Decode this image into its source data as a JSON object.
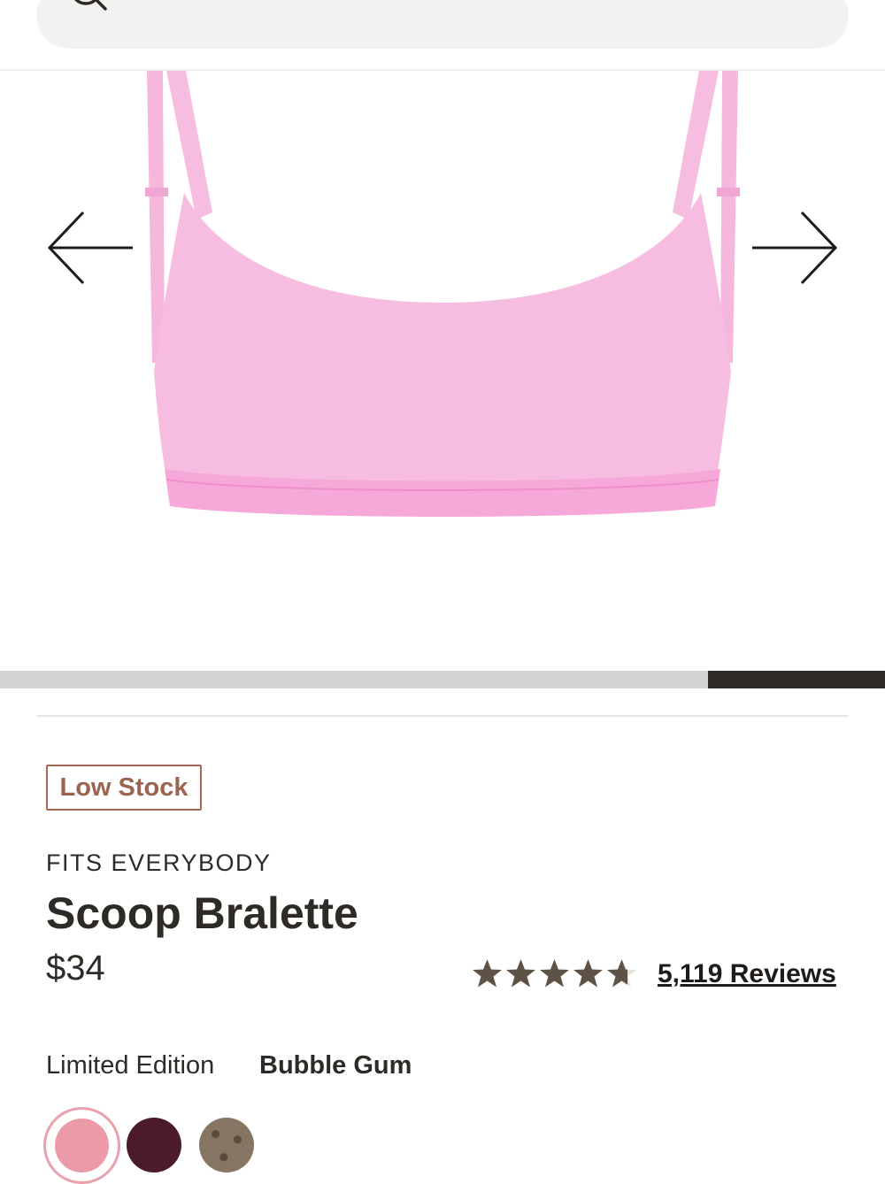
{
  "search": {
    "placeholder": "Search"
  },
  "gallery": {
    "prev_label": "previous image",
    "next_label": "next image",
    "progress_fraction": 0.2,
    "progress_start": 0.8
  },
  "product": {
    "badge": "Low Stock",
    "collection": "FITS EVERYBODY",
    "title": "Scoop Bralette",
    "price": "$34",
    "rating": 4.7,
    "reviews_label": "5,119 Reviews",
    "color_label": "Limited Edition",
    "color_name": "Bubble Gum"
  },
  "swatches": [
    {
      "name": "Bubble Gum",
      "color": "#ec9aa8",
      "selected": true
    },
    {
      "name": "Plum",
      "color": "#4b1b2c",
      "selected": false
    },
    {
      "name": "Leopard",
      "color": "#857562",
      "selected": false
    }
  ],
  "colors": {
    "text": "#2e2b27",
    "badge": "#9a6450",
    "star": "#5e5146",
    "product_pink": "#f7bde0"
  }
}
